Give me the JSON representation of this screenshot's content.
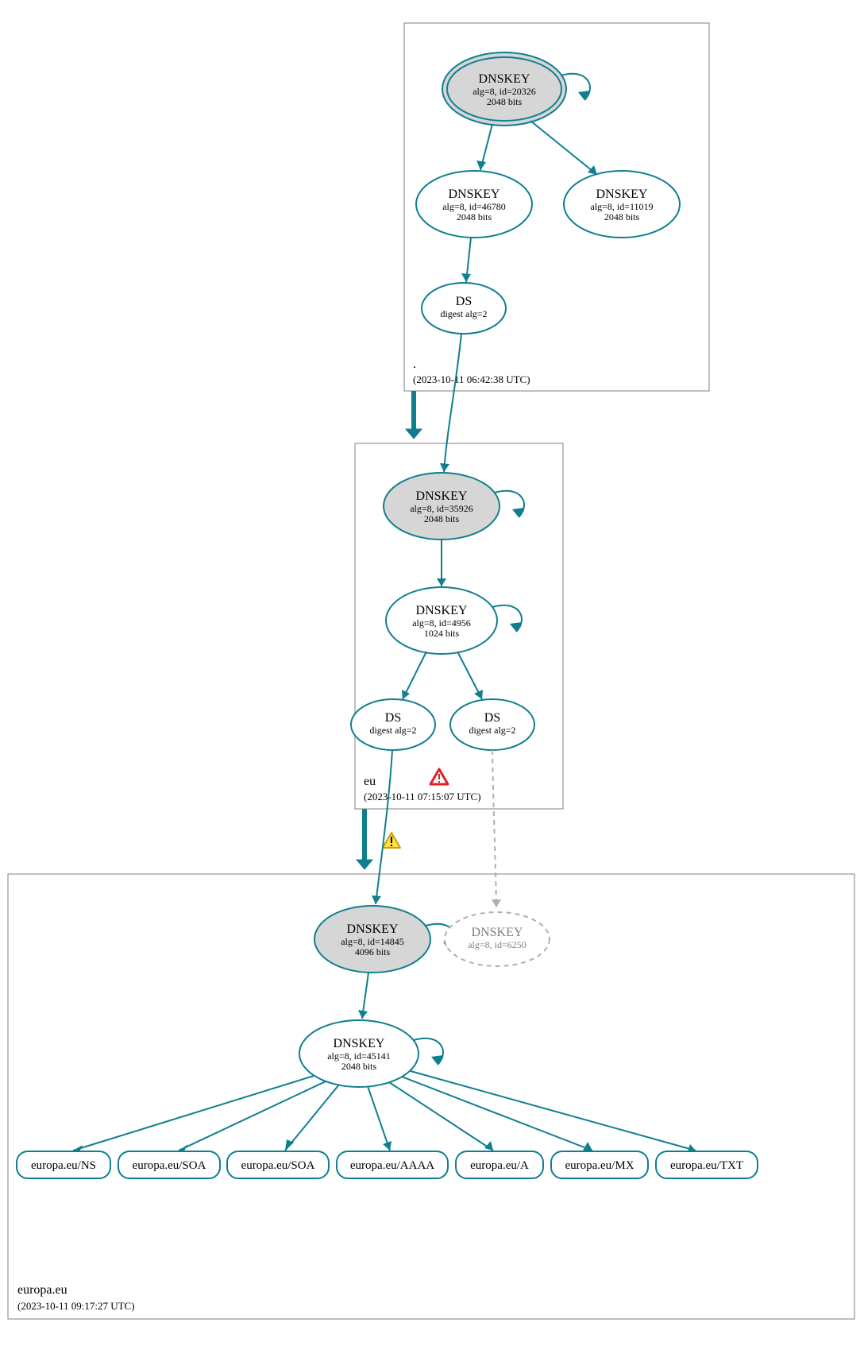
{
  "colors": {
    "stroke": "#0f7f8f",
    "ksk_fill": "#d6d6d6",
    "ghost": "#b0b0b0"
  },
  "zones": {
    "root": {
      "label": ".",
      "timestamp": "(2023-10-11 06:42:38 UTC)"
    },
    "eu": {
      "label": "eu",
      "timestamp": "(2023-10-11 07:15:07 UTC)"
    },
    "europa": {
      "label": "europa.eu",
      "timestamp": "(2023-10-11 09:17:27 UTC)"
    }
  },
  "nodes": {
    "root_ksk": {
      "title": "DNSKEY",
      "line2": "alg=8, id=20326",
      "line3": "2048 bits"
    },
    "root_zsk1": {
      "title": "DNSKEY",
      "line2": "alg=8, id=46780",
      "line3": "2048 bits"
    },
    "root_zsk2": {
      "title": "DNSKEY",
      "line2": "alg=8, id=11019",
      "line3": "2048 bits"
    },
    "root_ds": {
      "title": "DS",
      "line2": "digest alg=2"
    },
    "eu_ksk": {
      "title": "DNSKEY",
      "line2": "alg=8, id=35926",
      "line3": "2048 bits"
    },
    "eu_zsk": {
      "title": "DNSKEY",
      "line2": "alg=8, id=4956",
      "line3": "1024 bits"
    },
    "eu_ds1": {
      "title": "DS",
      "line2": "digest alg=2"
    },
    "eu_ds2": {
      "title": "DS",
      "line2": "digest alg=2"
    },
    "eur_ksk": {
      "title": "DNSKEY",
      "line2": "alg=8, id=14845",
      "line3": "4096 bits"
    },
    "eur_ghost": {
      "title": "DNSKEY",
      "line2": "alg=8, id=6250"
    },
    "eur_zsk": {
      "title": "DNSKEY",
      "line2": "alg=8, id=45141",
      "line3": "2048 bits"
    }
  },
  "rrsets": [
    "europa.eu/NS",
    "europa.eu/SOA",
    "europa.eu/SOA",
    "europa.eu/AAAA",
    "europa.eu/A",
    "europa.eu/MX",
    "europa.eu/TXT"
  ],
  "icons": {
    "warning_red": "warning-icon",
    "warning_yellow": "caution-icon"
  }
}
